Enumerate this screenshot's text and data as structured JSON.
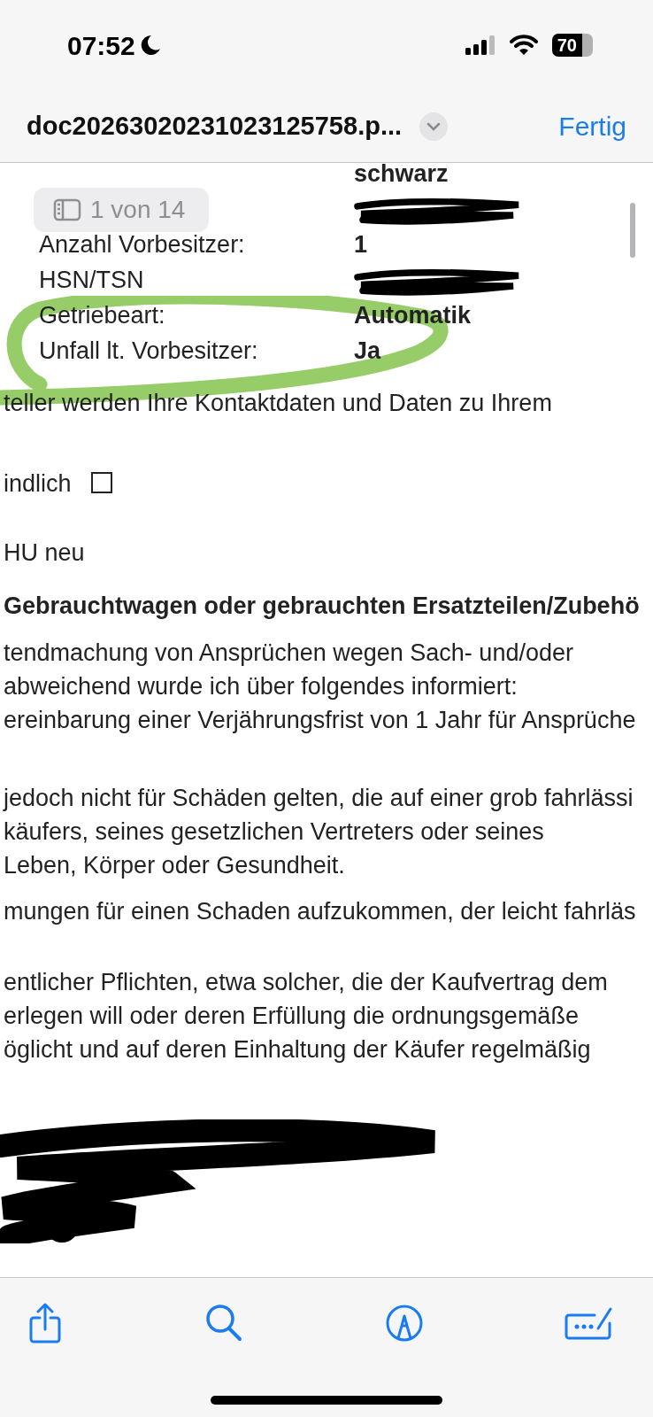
{
  "status_bar": {
    "time": "07:52",
    "battery": "70"
  },
  "nav_bar": {
    "title": "doc20263020231023125758.p...",
    "done": "Fertig"
  },
  "page_badge": {
    "text": "1 von 14"
  },
  "fields": [
    {
      "value": "schwarz"
    },
    {
      "redacted": true
    },
    {
      "label": "Anzahl Vorbesitzer:",
      "value": "1"
    },
    {
      "label": "HSN/TSN",
      "redacted": true
    },
    {
      "label": "Getriebeart:",
      "value": "Automatik"
    },
    {
      "label": "Unfall lt. Vorbesitzer:",
      "value": "Ja"
    }
  ],
  "blocks": [
    {
      "kind": "text",
      "lines": [
        "teller werden Ihre Kontaktdaten und Daten zu Ihrem"
      ]
    },
    {
      "kind": "checkbox",
      "lines": [
        "indlich"
      ],
      "checked": false
    },
    {
      "kind": "text",
      "lines": [
        "HU neu"
      ]
    },
    {
      "kind": "heading",
      "lines": [
        "Gebrauchtwagen oder gebrauchten Ersatzteilen/Zubehö"
      ]
    },
    {
      "kind": "text",
      "lines": [
        "tendmachung von Ansprüchen wegen Sach- und/oder",
        "abweichend wurde ich über folgendes informiert:",
        "ereinbarung einer Verjährungsfrist von 1 Jahr für Ansprüche"
      ]
    },
    {
      "kind": "text",
      "lines": [
        "jedoch nicht für Schäden gelten, die auf einer grob fahrlässi",
        "käufers, seines gesetzlichen Vertreters oder seines",
        "Leben, Körper oder Gesundheit."
      ]
    },
    {
      "kind": "text",
      "lines": [
        "mungen für einen Schaden aufzukommen, der leicht fahrläs"
      ]
    },
    {
      "kind": "text",
      "lines": [
        "entlicher Pflichten, etwa solcher, die der Kaufvertrag dem",
        "erlegen will oder deren Erfüllung die ordnungsgemäße",
        "öglicht und auf deren Einhaltung der Käufer regelmäßig"
      ]
    },
    {
      "kind": "redaction"
    }
  ]
}
